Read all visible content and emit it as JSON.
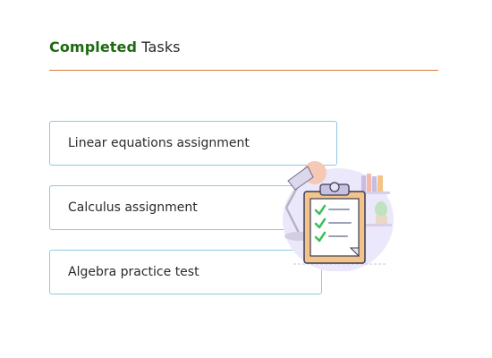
{
  "header": {
    "title_accent": "Completed",
    "title_rest": " Tasks"
  },
  "tasks": [
    {
      "label": "Linear equations assignment"
    },
    {
      "label": "Calculus assignment"
    },
    {
      "label": "Algebra practice test"
    }
  ],
  "colors": {
    "accent_green": "#1e6a12",
    "divider_orange": "#e07a3e",
    "card_border": "#8ccbe2",
    "check_green": "#3cc05a",
    "clipboard_orange": "#f3c487",
    "blob_lavender": "#ece8fb"
  },
  "illustration": {
    "icon": "clipboard-checklist-icon"
  }
}
